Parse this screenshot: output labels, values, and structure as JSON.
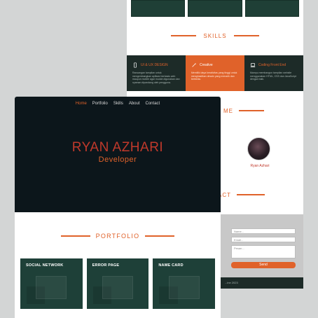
{
  "back_page": {
    "skills_title": "SKILLS",
    "skills": [
      {
        "label": "UI & UX DESIGN",
        "icon": "mobile-icon",
        "description": "Rancangan tampilan untuk mengembangkan aplikasi berbasis web maupun mobile agar mudah digunakan dan nyaman dipandang oleh pengguna.",
        "active": false
      },
      {
        "label": "Creative",
        "icon": "magic-wand-icon",
        "description": "Memiliki daya kreativitas yang tinggi untuk menghasilkan desain yang menarik dan berbeda.",
        "active": true
      },
      {
        "label": "Coding Front End",
        "icon": "laptop-icon",
        "description": "Mampu membangun tampilan website menggunakan HTML, CSS dan JavaScript dengan baik.",
        "active": false
      }
    ],
    "about_title_partial": "ME",
    "about_name": "Ryan Azhari",
    "contact_title_partial": "ACT",
    "contact_form": {
      "name_placeholder": "Name...",
      "email_placeholder": "Email...",
      "pesan_placeholder": "Pesan...",
      "send_label": "Send"
    },
    "footer_text": "...ine 2023"
  },
  "front_page": {
    "nav": [
      "Home",
      "Portfolio",
      "Skills",
      "About",
      "Contact"
    ],
    "active_nav": "Home",
    "hero_name": "RYAN AZHARI",
    "hero_role": "Developer",
    "portfolio_title": "PORTFOLIO",
    "portfolio_cards": [
      "SOCIAL NETWORK",
      "ERROR PAGE",
      "NAME CARD"
    ]
  },
  "colors": {
    "accent": "#e0622a",
    "hero_name": "#c0392b",
    "hero_bg": "#0c161b",
    "card_bg": "#1e4038",
    "skills_bg": "#1d2b28"
  }
}
